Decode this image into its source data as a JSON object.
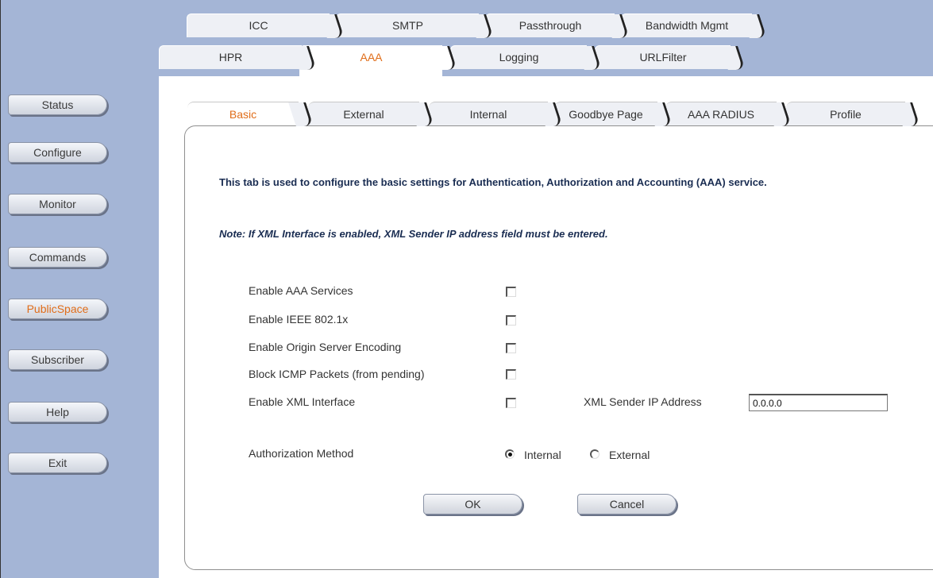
{
  "sidebar": {
    "items": [
      {
        "label": "Status",
        "active": false
      },
      {
        "label": "Configure",
        "active": false
      },
      {
        "label": "Monitor",
        "active": false
      },
      {
        "label": "Commands",
        "active": false
      },
      {
        "label": "PublicSpace",
        "active": true
      },
      {
        "label": "Subscriber",
        "active": false
      },
      {
        "label": "Help",
        "active": false
      },
      {
        "label": "Exit",
        "active": false
      }
    ]
  },
  "top_tabs_row1": [
    "ICC",
    "SMTP",
    "Passthrough",
    "Bandwidth Mgmt"
  ],
  "top_tabs_row2": [
    "HPR",
    "AAA",
    "Logging",
    "URLFilter"
  ],
  "active_top_tab": "AAA",
  "sub_tabs": [
    "Basic",
    "External",
    "Internal",
    "Goodbye Page",
    "AAA RADIUS",
    "Profile"
  ],
  "active_sub_tab": "Basic",
  "content": {
    "description": "This tab is used to configure the basic settings for Authentication, Authorization and Accounting (AAA) service.",
    "note": "Note: If XML Interface is enabled, XML Sender IP address field must be entered.",
    "options": [
      {
        "label": "Enable AAA Services",
        "checked": false
      },
      {
        "label": "Enable IEEE 802.1x",
        "checked": false
      },
      {
        "label": "Enable Origin Server Encoding",
        "checked": false
      },
      {
        "label": "Block ICMP Packets (from pending)",
        "checked": false
      },
      {
        "label": "Enable XML Interface",
        "checked": false
      }
    ],
    "xml_sender_label": "XML Sender IP Address",
    "xml_sender_value": "0.0.0.0",
    "auth_method_label": "Authorization Method",
    "auth_options": [
      {
        "label": "Internal",
        "selected": true
      },
      {
        "label": "External",
        "selected": false
      }
    ],
    "ok_label": "OK",
    "cancel_label": "Cancel"
  },
  "colors": {
    "sidebar_bg": "#a4b5d6",
    "active_text": "#e06d19",
    "heading_text": "#1a2d52"
  }
}
